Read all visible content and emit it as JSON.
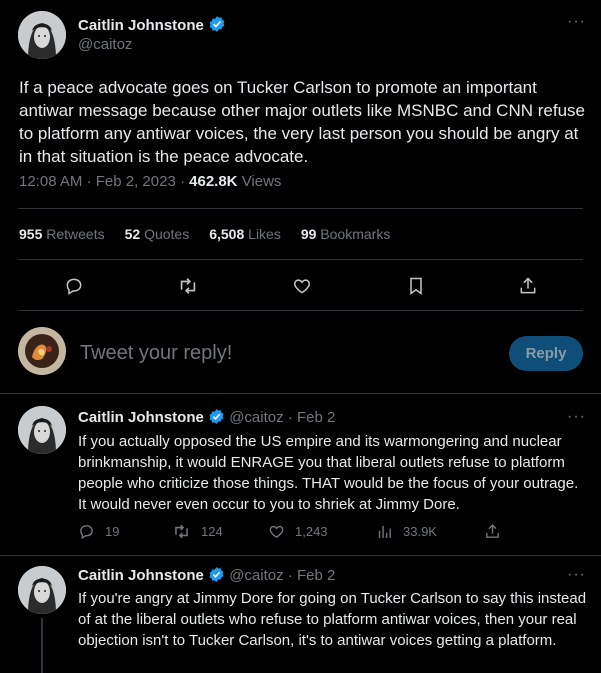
{
  "main_tweet": {
    "author_name": "Caitlin Johnstone",
    "author_handle": "@caitoz",
    "more": "···",
    "text": "If a peace advocate goes on Tucker Carlson to promote an important antiwar message because other major outlets like MSNBC and CNN refuse to platform any antiwar voices, the very last person you should be angry at in that situation is the peace advocate.",
    "time": "12:08 AM",
    "date": "Feb 2, 2023",
    "views_count": "462.8K",
    "views_label": "Views",
    "stats": {
      "retweets_count": "955",
      "retweets_label": "Retweets",
      "quotes_count": "52",
      "quotes_label": "Quotes",
      "likes_count": "6,508",
      "likes_label": "Likes",
      "bookmarks_count": "99",
      "bookmarks_label": "Bookmarks"
    },
    "actions": [
      "reply-icon",
      "retweet-icon",
      "like-icon",
      "bookmark-icon",
      "share-icon"
    ]
  },
  "composer": {
    "placeholder": "Tweet your reply!",
    "button_label": "Reply"
  },
  "replies": [
    {
      "author_name": "Caitlin Johnstone",
      "author_handle": "@caitoz",
      "separator": "·",
      "date": "Feb 2",
      "more": "···",
      "text": "If you actually opposed the US empire and its warmongering and nuclear brinkmanship, it would ENRAGE you that liberal outlets refuse to platform people who criticize those things. THAT would be the focus of your outrage. It would never even occur to you to shriek at Jimmy Dore.",
      "reply_count": "19",
      "retweet_count": "124",
      "like_count": "1,243",
      "view_count": "33.9K"
    },
    {
      "author_name": "Caitlin Johnstone",
      "author_handle": "@caitoz",
      "separator": "·",
      "date": "Feb 2",
      "more": "···",
      "text": "If you're angry at Jimmy Dore for going on Tucker Carlson to say this instead of at the liberal outlets who refuse to platform antiwar voices, then your real objection isn't to Tucker Carlson, it's to antiwar voices getting a platform."
    }
  ],
  "colors": {
    "background": "#000000",
    "text": "#e7e9ea",
    "muted": "#71767b",
    "accent_blue": "#1d9bf0",
    "divider": "#2f3336",
    "reply_button_disabled": "#0f4e78"
  }
}
